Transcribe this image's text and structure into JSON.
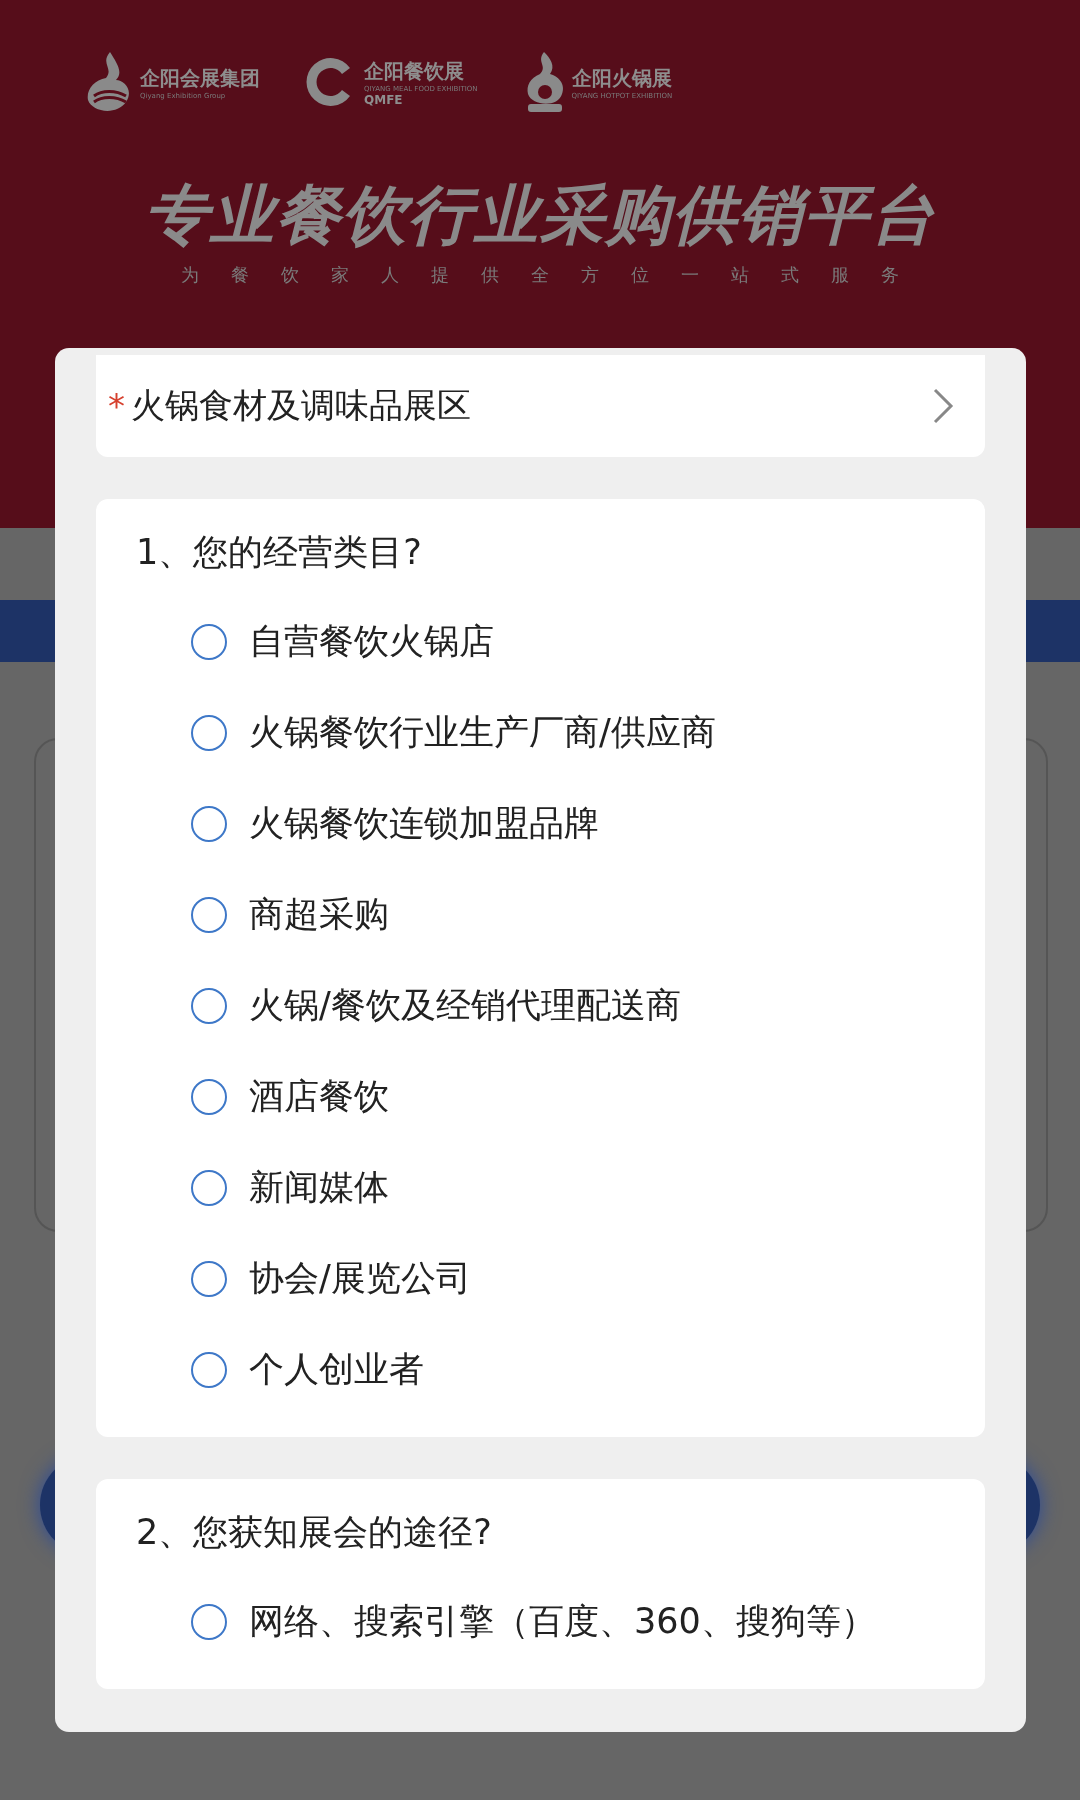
{
  "logos": [
    {
      "kind": "flame",
      "name": "企阳会展集团",
      "subtitle": "Qiyang Exhibition Group"
    },
    {
      "kind": "ring",
      "name": "企阳餐饮展",
      "subtitle": "QIYANG MEAL FOOD EXHIBITION",
      "acronym": "QMFE"
    },
    {
      "kind": "pot",
      "name": "企阳火锅展",
      "subtitle": "QIYANG HOTPOT EXHIBITION"
    }
  ],
  "banner": {
    "title": "专业餐饮行业采购供销平台",
    "subtitle": "为餐饮家人提供全方位一站式服务"
  },
  "exhibit_area": {
    "required_mark": "*",
    "value": "火锅食材及调味品展区"
  },
  "questions": [
    {
      "title": "1、您的经营类目?",
      "options": [
        {
          "label": "自营餐饮火锅店",
          "selected": false
        },
        {
          "label": "火锅餐饮行业生产厂商/供应商",
          "selected": false
        },
        {
          "label": "火锅餐饮连锁加盟品牌",
          "selected": false
        },
        {
          "label": "商超采购",
          "selected": false
        },
        {
          "label": "火锅/餐饮及经销代理配送商",
          "selected": false
        },
        {
          "label": "酒店餐饮",
          "selected": false
        },
        {
          "label": "新闻媒体",
          "selected": false
        },
        {
          "label": "协会/展览公司",
          "selected": false
        },
        {
          "label": "个人创业者",
          "selected": false
        }
      ]
    },
    {
      "title": "2、您获知展会的途径?",
      "options": [
        {
          "label": "网络、搜索引擎（百度、360、搜狗等）",
          "selected": false
        }
      ]
    }
  ]
}
